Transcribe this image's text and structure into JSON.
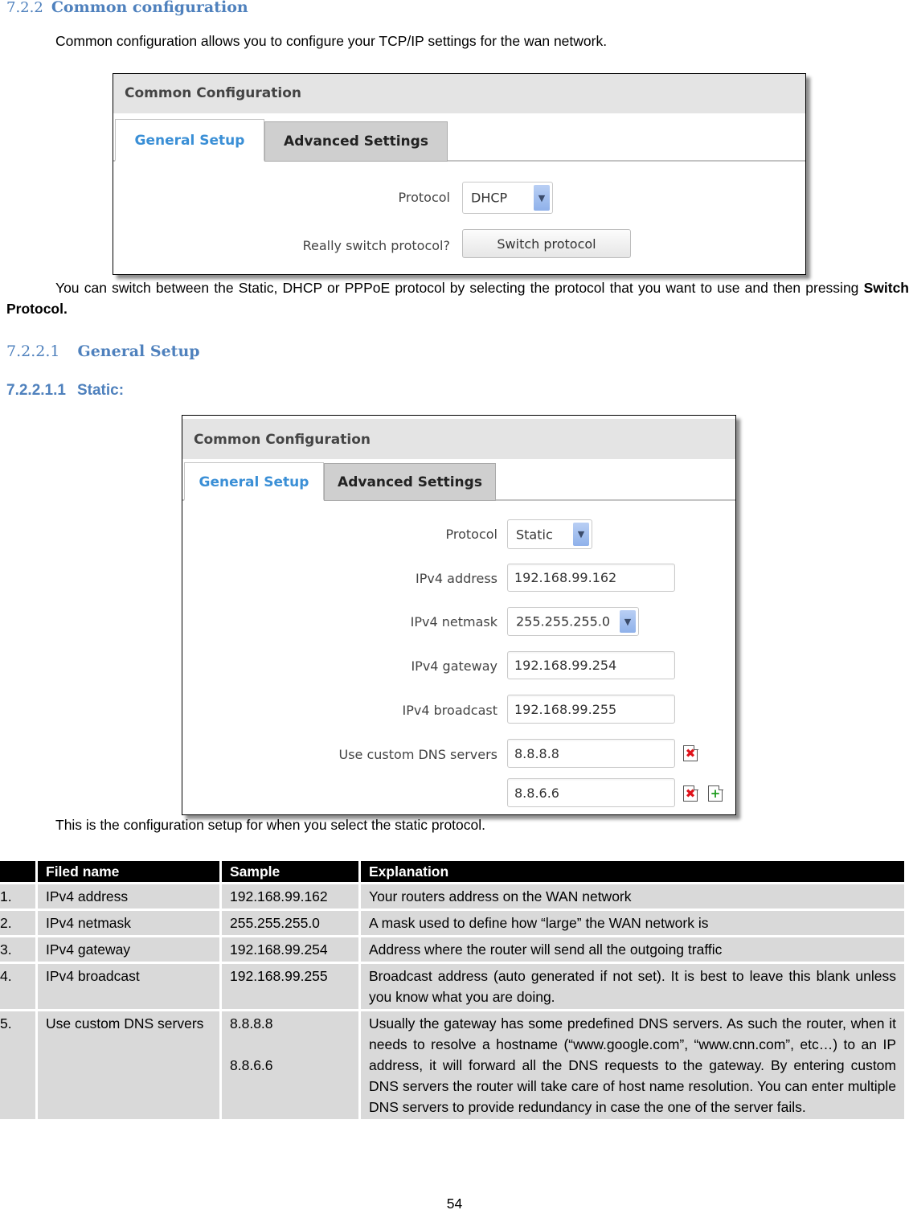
{
  "heading_722": {
    "number": "7.2.2",
    "title": "Common configuration"
  },
  "intro_text": "Common configuration allows you to configure your TCP/IP settings for the wan network.",
  "screenshot1": {
    "panel_title": "Common Configuration",
    "tabs": [
      {
        "label": "General Setup",
        "active": true
      },
      {
        "label": "Advanced Settings",
        "active": false
      }
    ],
    "protocol_label": "Protocol",
    "protocol_value": "DHCP",
    "switch_label": "Really switch protocol?",
    "switch_button": "Switch protocol"
  },
  "switch_paragraph": {
    "text": "You can switch between the Static, DHCP or PPPoE protocol by selecting the protocol that you want to use and then pressing ",
    "bold": "Switch Protocol."
  },
  "heading_7221": {
    "number": "7.2.2.1",
    "title": "General Setup"
  },
  "heading_72211": {
    "number": "7.2.2.1.1",
    "title": "Static:"
  },
  "screenshot2": {
    "panel_title": "Common Configuration",
    "tabs": [
      {
        "label": "General Setup",
        "active": true
      },
      {
        "label": "Advanced Settings",
        "active": false
      }
    ],
    "fields": {
      "protocol": {
        "label": "Protocol",
        "value": "Static"
      },
      "ipv4_address": {
        "label": "IPv4 address",
        "value": "192.168.99.162"
      },
      "ipv4_netmask": {
        "label": "IPv4 netmask",
        "value": "255.255.255.0"
      },
      "ipv4_gateway": {
        "label": "IPv4 gateway",
        "value": "192.168.99.254"
      },
      "ipv4_broadcast": {
        "label": "IPv4 broadcast",
        "value": "192.168.99.255"
      },
      "dns_label": "Use custom DNS servers",
      "dns_servers": [
        "8.8.8.8",
        "8.8.6.6"
      ]
    },
    "icons": {
      "remove": "✖",
      "add": "+"
    }
  },
  "static_caption": "This is the configuration setup for when you select the static protocol.",
  "table": {
    "headers": [
      "",
      "Filed name",
      "Sample",
      "Explanation"
    ],
    "rows": [
      {
        "num": "1.",
        "field": "IPv4 address",
        "sample": "192.168.99.162",
        "sample2": "",
        "explanation": "Your routers address on the WAN network"
      },
      {
        "num": "2.",
        "field": "IPv4 netmask",
        "sample": "255.255.255.0",
        "sample2": "",
        "explanation": "A mask used to define how “large” the WAN network is"
      },
      {
        "num": "3.",
        "field": "IPv4 gateway",
        "sample": "192.168.99.254",
        "sample2": "",
        "explanation": "Address where the router will send all the outgoing traffic"
      },
      {
        "num": "4.",
        "field": "IPv4 broadcast",
        "sample": "192.168.99.255",
        "sample2": "",
        "explanation": "Broadcast address (auto generated if not set). It is best to leave this blank unless you know what you are doing."
      },
      {
        "num": "5.",
        "field": "Use custom DNS servers",
        "sample": "8.8.8.8",
        "sample2": "8.8.6.6",
        "explanation": "Usually the gateway has some predefined DNS servers. As such the router, when it needs to resolve a hostname (“www.google.com”, “www.cnn.com”, etc…) to an IP address, it will forward all the DNS requests to the gateway. By entering custom DNS servers the router will take care of host name resolution. You can enter multiple DNS servers to provide redundancy in case the one of the server fails."
      }
    ]
  },
  "page_number": "54"
}
